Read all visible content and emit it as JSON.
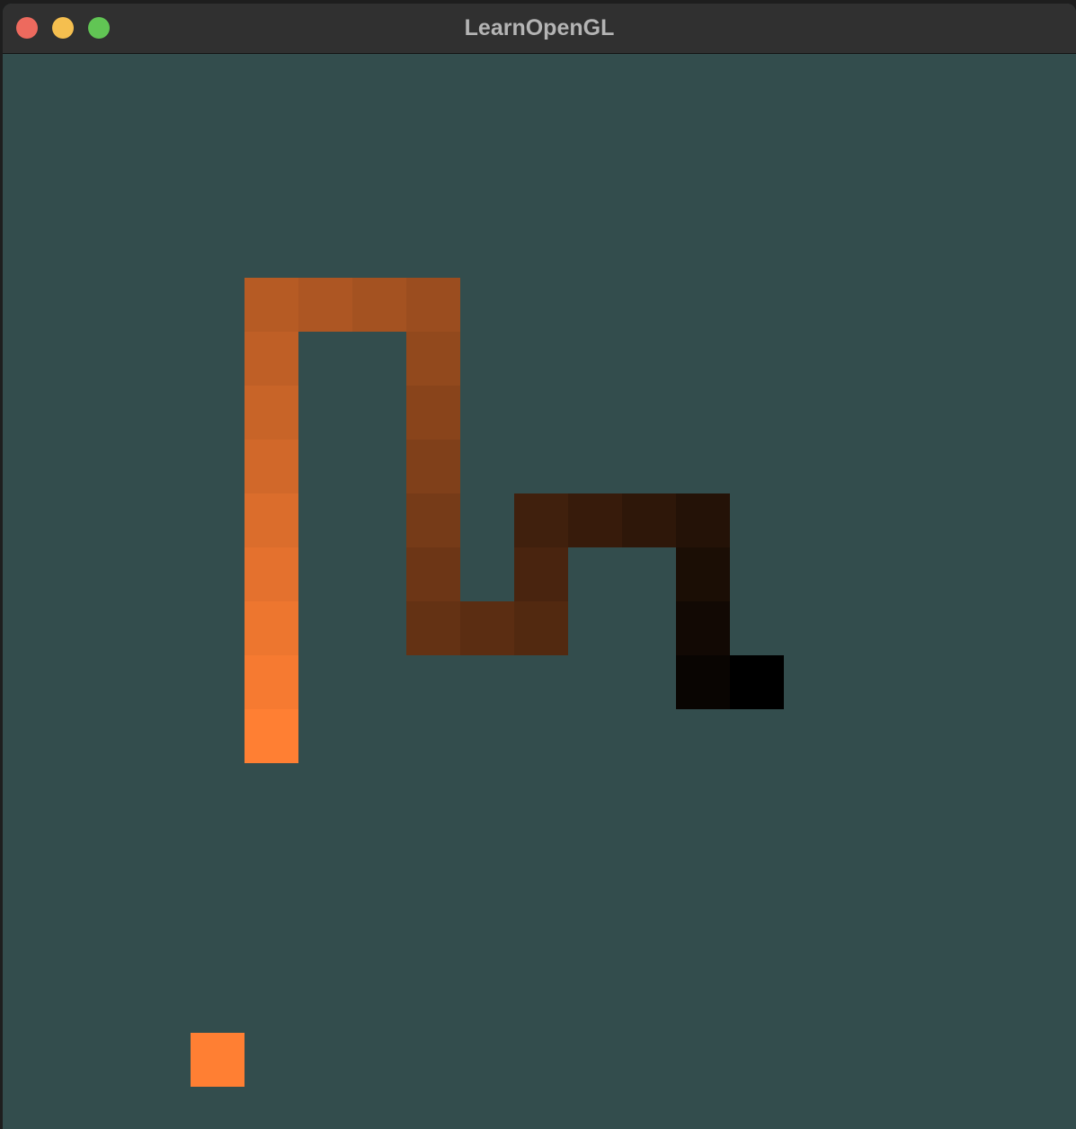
{
  "window": {
    "title": "LearnOpenGL",
    "background_color": "#334d4d"
  },
  "game": {
    "type": "snake",
    "grid_columns": 20,
    "grid_rows": 20,
    "snake": {
      "head_color": "#000000",
      "tail_color": "#ff7f33",
      "segments": [
        {
          "col": 4,
          "row": 12
        },
        {
          "col": 4,
          "row": 11
        },
        {
          "col": 4,
          "row": 10
        },
        {
          "col": 4,
          "row": 9
        },
        {
          "col": 4,
          "row": 8
        },
        {
          "col": 4,
          "row": 7
        },
        {
          "col": 4,
          "row": 6
        },
        {
          "col": 4,
          "row": 5
        },
        {
          "col": 4,
          "row": 4
        },
        {
          "col": 5,
          "row": 4
        },
        {
          "col": 6,
          "row": 4
        },
        {
          "col": 7,
          "row": 4
        },
        {
          "col": 7,
          "row": 5
        },
        {
          "col": 7,
          "row": 6
        },
        {
          "col": 7,
          "row": 7
        },
        {
          "col": 7,
          "row": 8
        },
        {
          "col": 7,
          "row": 9
        },
        {
          "col": 7,
          "row": 10
        },
        {
          "col": 8,
          "row": 10
        },
        {
          "col": 9,
          "row": 10
        },
        {
          "col": 9,
          "row": 9
        },
        {
          "col": 9,
          "row": 8
        },
        {
          "col": 10,
          "row": 8
        },
        {
          "col": 11,
          "row": 8
        },
        {
          "col": 12,
          "row": 8
        },
        {
          "col": 12,
          "row": 9
        },
        {
          "col": 12,
          "row": 10
        },
        {
          "col": 12,
          "row": 11
        },
        {
          "col": 13,
          "row": 11
        }
      ]
    },
    "food": {
      "col": 3,
      "row": 18,
      "color": "#ff7f33"
    }
  }
}
